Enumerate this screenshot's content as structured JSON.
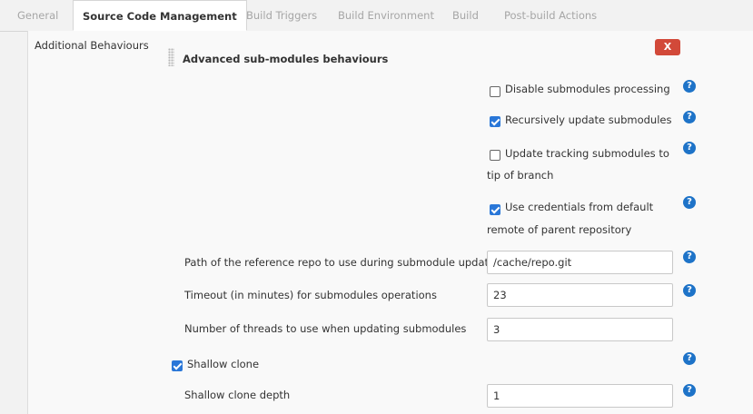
{
  "tabs": [
    {
      "label": "General"
    },
    {
      "label": "Source Code Management"
    },
    {
      "label": "Build Triggers"
    },
    {
      "label": "Build Environment"
    },
    {
      "label": "Build"
    },
    {
      "label": "Post-build Actions"
    }
  ],
  "section": {
    "label": "Additional Behaviours",
    "heading": "Advanced sub-modules behaviours",
    "close_label": "X"
  },
  "options": {
    "disable_submodules": {
      "label": "Disable submodules processing",
      "checked": false
    },
    "recursive_update": {
      "label": "Recursively update submodules",
      "checked": true
    },
    "tracking_submodules": {
      "label_line1": "Update tracking submodules to",
      "label_line2": "tip of branch",
      "checked": false
    },
    "use_credentials": {
      "label_line1": "Use credentials from default",
      "label_line2": "remote of parent repository",
      "checked": true
    }
  },
  "fields": {
    "reference_repo": {
      "label": "Path of the reference repo to use during submodule update",
      "value": "/cache/repo.git"
    },
    "timeout": {
      "label": "Timeout (in minutes) for submodules operations",
      "value": "23"
    },
    "threads": {
      "label": "Number of threads to use when updating submodules",
      "value": "3"
    },
    "shallow_clone": {
      "label": "Shallow clone",
      "checked": true
    },
    "shallow_depth": {
      "label": "Shallow clone depth",
      "value": "1"
    }
  },
  "help_label": "?",
  "colors": {
    "accent": "#2a77d8",
    "help": "#1e73c8",
    "delete": "#d24939"
  }
}
